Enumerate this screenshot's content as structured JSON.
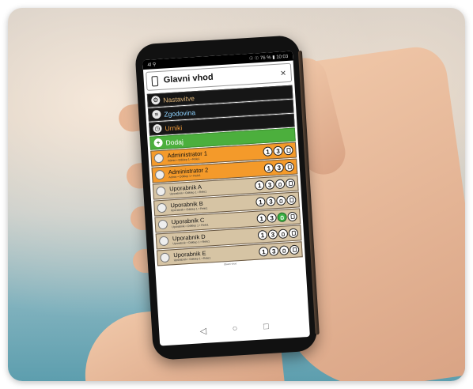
{
  "status_bar": {
    "left": "4l ⚲",
    "right": "☉ ☉ 76 % ▮ 10:03"
  },
  "header": {
    "title": "Glavni vhod",
    "close_label": "×"
  },
  "menu": [
    {
      "label": "Nastavitve",
      "icon": "gear-icon"
    },
    {
      "label": "Zgodovina",
      "icon": "list-icon"
    },
    {
      "label": "Urniki",
      "icon": "clock-icon"
    },
    {
      "label": "Dodaj",
      "icon": "plus-icon"
    }
  ],
  "users": [
    {
      "name": "Administrator 1",
      "sub": "Admin • Odklep 1 • Rele1",
      "role": "admin",
      "b1": "1",
      "b2": "3",
      "bulb_on": false
    },
    {
      "name": "Administrator 2",
      "sub": "Admin • Odklep 1 • Rele1",
      "role": "admin",
      "b1": "1",
      "b2": "3",
      "bulb_on": false
    },
    {
      "name": "Uporabnik A",
      "sub": "Uporabnik • Odklep 1 • Rele1",
      "role": "user",
      "b1": "1",
      "b2": "3",
      "bulb_on": false
    },
    {
      "name": "Uporabnik B",
      "sub": "Uporabnik • Odklep 1 • Rele1",
      "role": "user",
      "b1": "1",
      "b2": "3",
      "bulb_on": false
    },
    {
      "name": "Uporabnik C",
      "sub": "Uporabnik • Odklep 1 • Rele1",
      "role": "user",
      "b1": "1",
      "b2": "3",
      "bulb_on": true
    },
    {
      "name": "Uporabnik D",
      "sub": "Uporabnik • Odklep 1 • Rele1",
      "role": "user",
      "b1": "1",
      "b2": "3",
      "bulb_on": false
    },
    {
      "name": "Uporabnik E",
      "sub": "Uporabnik • Odklep 1 • Rele1",
      "role": "user",
      "b1": "1",
      "b2": "3",
      "bulb_on": false
    }
  ],
  "footer": {
    "version": "Glavni vhod"
  },
  "nav": {
    "back": "◁",
    "home": "○",
    "recent": "□"
  },
  "colors": {
    "admin": "#f49a2a",
    "user": "#d6c4a4",
    "add": "#4caf3d",
    "active_bulb": "#3cb043"
  }
}
